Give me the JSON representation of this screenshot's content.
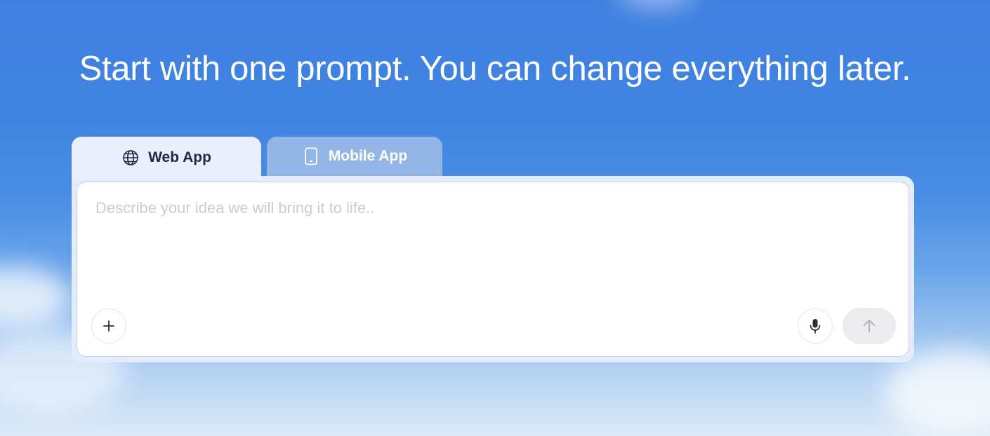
{
  "hero": {
    "title": "Start with one prompt. You can change everything later."
  },
  "tabs": [
    {
      "label": "Web App",
      "icon": "globe-icon",
      "selected": true
    },
    {
      "label": "Mobile App",
      "icon": "mobile-phone-icon",
      "selected": false
    }
  ],
  "prompt": {
    "placeholder": "Describe your idea we will bring it to life..",
    "value": ""
  },
  "actions": {
    "add_icon": "plus-icon",
    "mic_icon": "microphone-icon",
    "send_icon": "arrow-up-icon"
  },
  "colors": {
    "sky_blue": "#4185e2",
    "tab_active_bg": "#e9f0fb",
    "tab_inactive_bg": "#94b6e6",
    "text_dark": "#1d2a44",
    "placeholder": "#c8ccd4",
    "send_disabled_bg": "#ececee"
  }
}
